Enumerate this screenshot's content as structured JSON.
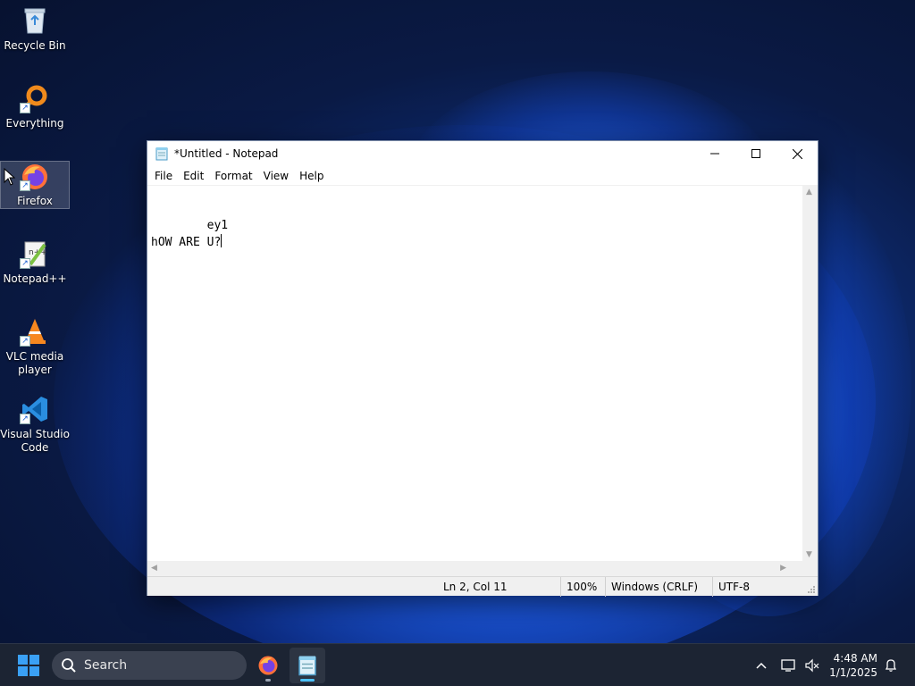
{
  "desktop": {
    "icons": [
      {
        "label": "Recycle Bin"
      },
      {
        "label": "Everything"
      },
      {
        "label": "Firefox"
      },
      {
        "label": "Notepad++"
      },
      {
        "label": "VLC media\nplayer"
      },
      {
        "label": "Visual Studio\nCode"
      }
    ]
  },
  "notepad": {
    "title": "*Untitled - Notepad",
    "menu": [
      "File",
      "Edit",
      "Format",
      "View",
      "Help"
    ],
    "content": {
      "line1": "        ey1",
      "line2": "hOW ARE U?"
    },
    "status": {
      "position": "Ln 2, Col 11",
      "zoom": "100%",
      "line_ending": "Windows (CRLF)",
      "encoding": "UTF-8"
    }
  },
  "taskbar": {
    "search_placeholder": "Search",
    "time": "4:48 AM",
    "date": "1/1/2025",
    "accent": "#4cc2ff"
  }
}
